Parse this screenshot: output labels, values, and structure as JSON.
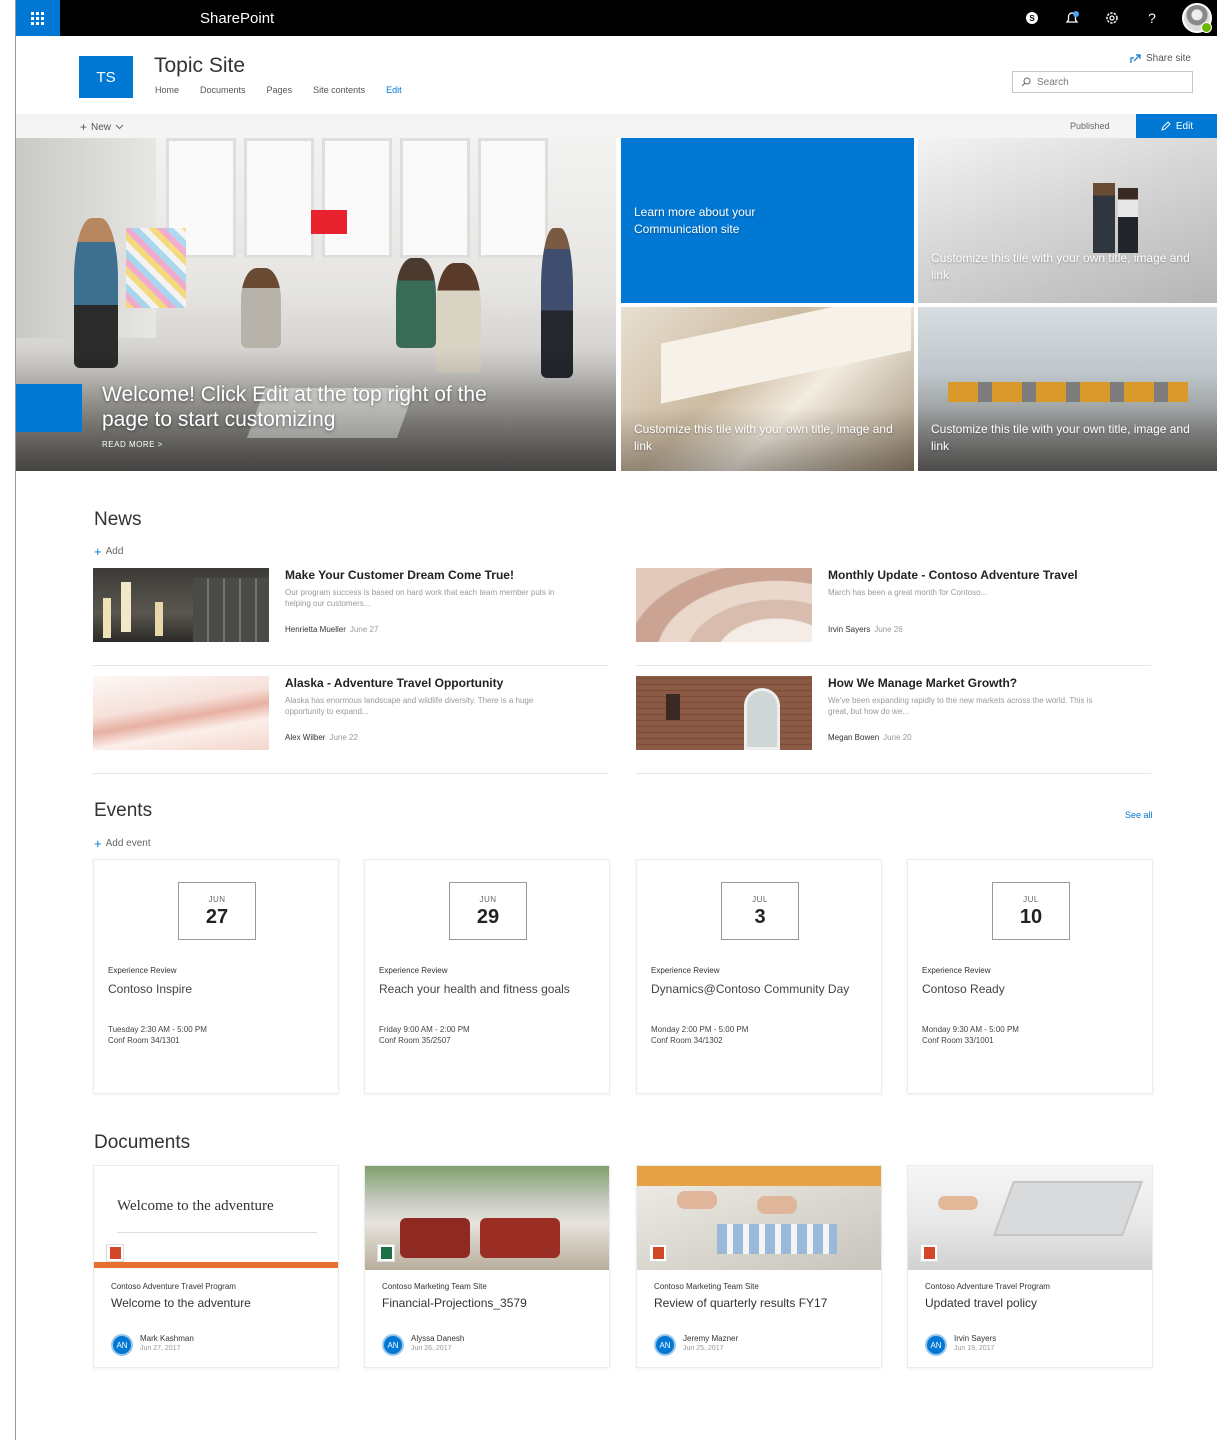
{
  "suite": {
    "brand": "SharePoint",
    "icons": [
      "skype-icon",
      "notifications-icon",
      "settings-icon",
      "help-icon",
      "profile-avatar"
    ],
    "help_label": "?"
  },
  "site": {
    "logo_initials": "TS",
    "title": "Topic Site",
    "nav": [
      "Home",
      "Documents",
      "Pages",
      "Site contents",
      "Edit"
    ],
    "share_label": "Share site",
    "search_placeholder": "Search"
  },
  "command_bar": {
    "new_label": "New",
    "status": "Published",
    "edit_label": "Edit"
  },
  "hero": {
    "main_title": "Welcome! Click Edit at the top right of the page to start customizing",
    "read_more": "READ MORE >",
    "tiles": [
      "Learn more about your Communication site",
      "Customize this tile with your own title, image and link",
      "Customize this tile with your own title, image and link",
      "Customize this tile with your own title, image and link"
    ]
  },
  "news": {
    "title": "News",
    "add_label": "Add",
    "items": [
      {
        "title": "Make Your Customer Dream Come True!",
        "desc": "Our program success is based on hard work that each team member puts in helping our customers...",
        "author": "Henrietta Mueller",
        "date": "June 27"
      },
      {
        "title": "Monthly Update - Contoso Adventure Travel",
        "desc": "March has been a great month for Contoso...",
        "author": "Irvin Sayers",
        "date": "June 26"
      },
      {
        "title": "Alaska - Adventure Travel Opportunity",
        "desc": "Alaska has enormous landscape and wildlife diversity. There is a huge opportunity to expand...",
        "author": "Alex Wilber",
        "date": "June 22"
      },
      {
        "title": "How We Manage Market Growth?",
        "desc": "We've been expanding rapidly to the new markets across the world. This is great, but how do we...",
        "author": "Megan Bowen",
        "date": "June 20"
      }
    ]
  },
  "events": {
    "title": "Events",
    "add_label": "Add event",
    "see_all": "See all",
    "items": [
      {
        "month": "JUN",
        "day": "27",
        "category": "Experience Review",
        "title": "Contoso Inspire",
        "time": "Tuesday 2:30 AM - 5:00 PM",
        "location": "Conf Room 34/1301"
      },
      {
        "month": "JUN",
        "day": "29",
        "category": "Experience Review",
        "title": "Reach your health and fitness goals",
        "time": "Friday 9:00 AM - 2:00 PM",
        "location": "Conf Room 35/2507"
      },
      {
        "month": "JUL",
        "day": "3",
        "category": "Experience Review",
        "title": "Dynamics@Contoso Community Day",
        "time": "Monday 2:00 PM - 5:00 PM",
        "location": "Conf Room 34/1302"
      },
      {
        "month": "JUL",
        "day": "10",
        "category": "Experience Review",
        "title": "Contoso Ready",
        "time": "Monday 9:30 AM - 5:00 PM",
        "location": "Conf Room 33/1001"
      }
    ]
  },
  "documents": {
    "title": "Documents",
    "preview_text": "Welcome to the adventure",
    "items": [
      {
        "site": "Contoso Adventure Travel Program",
        "title": "Welcome to the adventure",
        "author": "Mark Kashman",
        "date": "Jun 27, 2017",
        "initials": "AN",
        "file_type": "pptx"
      },
      {
        "site": "Contoso Marketing Team Site",
        "title": "Financial-Projections_3579",
        "author": "Alyssa Danesh",
        "date": "Jun 26, 2017",
        "initials": "AN",
        "file_type": "xlsx"
      },
      {
        "site": "Contoso Marketing Team Site",
        "title": "Review of quarterly results FY17",
        "author": "Jeremy Mazner",
        "date": "Jun 25, 2017",
        "initials": "AN",
        "file_type": "pptx"
      },
      {
        "site": "Contoso Adventure Travel Program",
        "title": "Updated travel policy",
        "author": "Irvin Sayers",
        "date": "Jun 19, 2017",
        "initials": "AN",
        "file_type": "pptx"
      }
    ]
  },
  "colors": {
    "accent": "#0078d4",
    "suite_bar": "#000000",
    "powerpoint": "#d24726",
    "excel": "#1e7145"
  }
}
